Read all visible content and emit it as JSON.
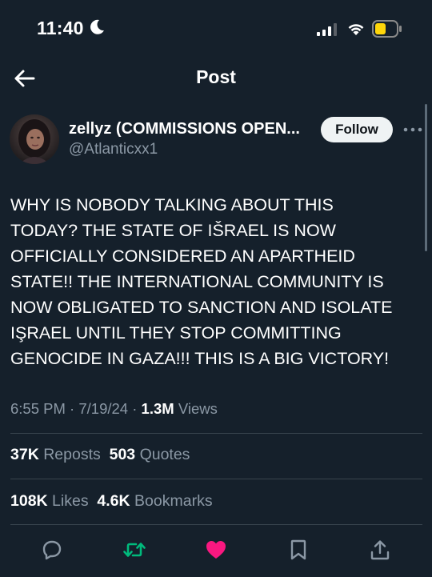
{
  "status_bar": {
    "time": "11:40"
  },
  "header": {
    "title": "Post"
  },
  "author": {
    "display_name": "zellyz (COMMISSIONS OPEN...",
    "handle": "@Atlanticxx1",
    "follow_label": "Follow"
  },
  "post": {
    "lines": [
      "WHY IS NOBODY TALKING ABOUT THIS",
      "TODAY? THE STATE OF IŠRAEL IS NOW",
      "OFFICIALLY CONSIDERED AN APARTHEID",
      "STATE!! THE INTERNATIONAL COMMUNITY IS",
      "NOW OBLIGATED TO SANCTION AND ISOLATE",
      "IŞRAEL UNTIL THEY STOP COMMITTING",
      "GENOCIDE IN GAZA!!! THIS IS A BIG VICTORY!"
    ]
  },
  "meta": {
    "time": "6:55 PM",
    "separator": " · ",
    "date": "7/19/24",
    "separator2": " · ",
    "views_count": "1.3M",
    "views_label": "Views"
  },
  "stats": {
    "reposts_count": "37K",
    "reposts_label": "Reposts",
    "quotes_count": "503",
    "quotes_label": "Quotes",
    "likes_count": "108K",
    "likes_label": "Likes",
    "bookmarks_count": "4.6K",
    "bookmarks_label": "Bookmarks"
  },
  "colors": {
    "background": "#15202b",
    "secondary_text": "#8b98a5",
    "repost_green": "#00ba7c",
    "like_pink": "#f91880",
    "battery_yellow": "#ffd60a"
  },
  "icons": {
    "back": "arrow-left-icon",
    "more": "more-horizontal-icon",
    "reply": "reply-icon",
    "repost": "repost-icon",
    "like": "heart-icon",
    "bookmark": "bookmark-icon",
    "share": "share-icon"
  }
}
